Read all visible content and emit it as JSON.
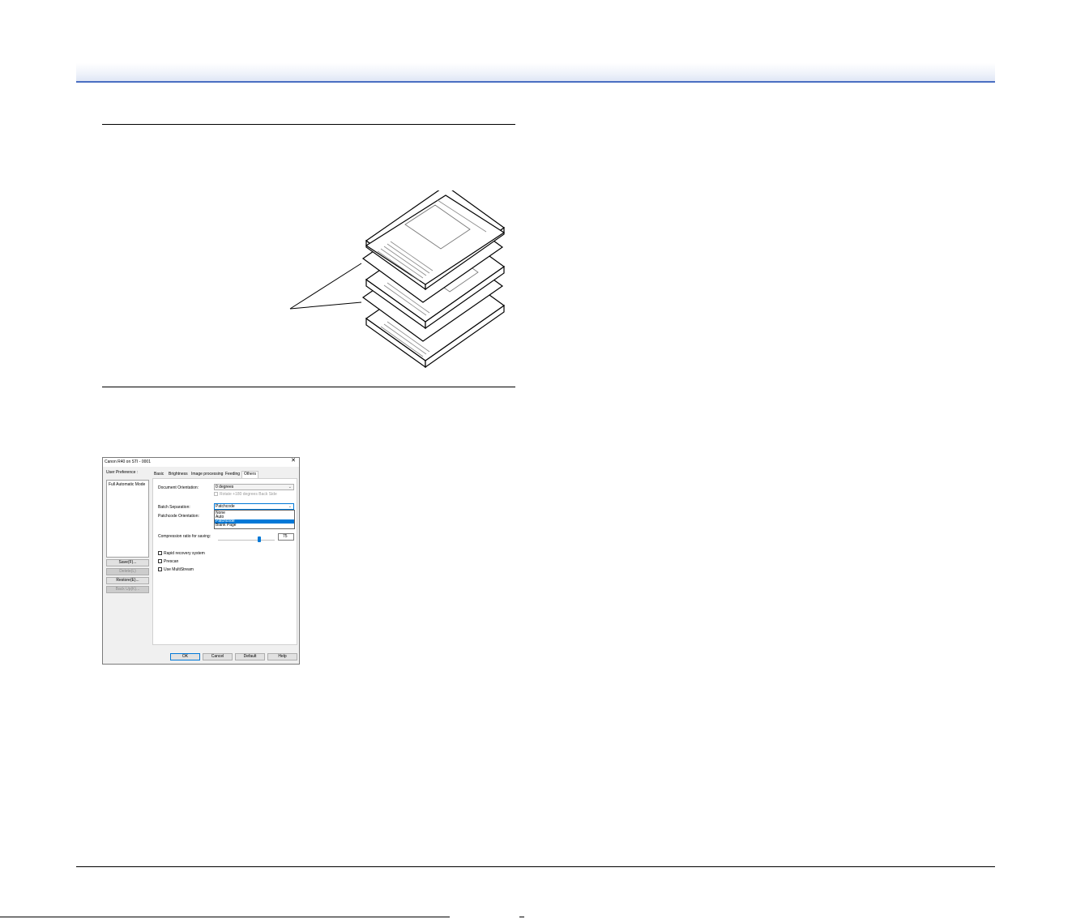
{
  "dialog": {
    "title": "Canon R40 on STI - 0001",
    "close_glyph": "✕",
    "user_preference_label": "User Preference :",
    "user_preference_items": [
      "Full Automatic Mode"
    ],
    "side_buttons": {
      "save": "Save(F)...",
      "delete": "Delete(L)",
      "restore": "Restore(E)...",
      "backup": "Back Up(K)..."
    },
    "tabs": [
      "Basic",
      "Brightness",
      "Image processing",
      "Feeding",
      "Others"
    ],
    "active_tab": "Others",
    "document_orientation_label": "Document Orientation:",
    "document_orientation_value": "0 degrees",
    "rotate_back_label": "Rotate +180 degrees Back Side",
    "batch_separation_label": "Batch Separation:",
    "batch_separation_value": "Patchcode",
    "batch_separation_options": [
      "None",
      "Auto",
      "Patchcode",
      "Blank Page"
    ],
    "batch_separation_selected": "Patchcode",
    "patchcode_orientation_label": "Patchcode Orientation:",
    "compression_label": "Compression ratio for saving:",
    "compression_value": "75",
    "compression_fraction": 0.73,
    "checkboxes": [
      {
        "label": "Rapid recovery system",
        "checked": false
      },
      {
        "label": "Prescan",
        "checked": false
      },
      {
        "label": "Use MultiStream",
        "checked": false
      }
    ],
    "bottom_buttons": {
      "ok": "OK",
      "cancel": "Cancel",
      "default": "Default",
      "help": "Help"
    }
  },
  "icons": {
    "close": "close-icon",
    "dropdown_arrow": "chevron-down-icon",
    "spin": "spin-arrows-icon"
  },
  "colors": {
    "header_rule": "#4a6fc2",
    "selection": "#0078d7"
  }
}
